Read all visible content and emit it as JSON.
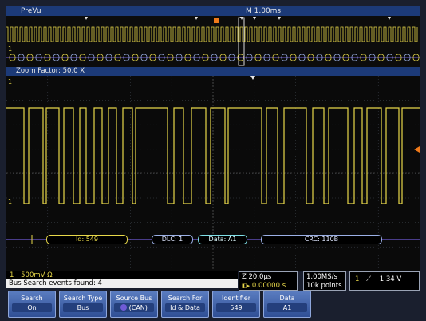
{
  "header": {
    "mode": "PreVu",
    "timebase": "M 1.00ms"
  },
  "zoom": {
    "label": "Zoom Factor: 50.0 X"
  },
  "bus": {
    "fields": [
      "Id: 549",
      "DLC: 1",
      "Data: A1",
      "CRC: 110B"
    ],
    "colors": {
      "id": "#e8d84a",
      "dlc": "#9bb0e6",
      "data": "#7fe0e8",
      "crc": "#9bb0e6",
      "line": "#6f5bd6"
    }
  },
  "channel": {
    "num": "1",
    "scale": "500mV Ω"
  },
  "status": {
    "search_result": "Bus Search events found: 4"
  },
  "readout": {
    "zoom_time": "Z 20.0μs",
    "position": "0.00000 s",
    "sample_rate": "1.00MS/s",
    "record": "10k points",
    "trig_level": "1.34 V"
  },
  "buttons": [
    {
      "title": "Search",
      "value": "On"
    },
    {
      "title": "Search Type",
      "value": "Bus"
    },
    {
      "title": "Source Bus",
      "value": "(CAN)"
    },
    {
      "title": "Search For",
      "value": "Id & Data"
    },
    {
      "title": "Identifier",
      "value": "549"
    },
    {
      "title": "Data",
      "value": "A1"
    }
  ],
  "colors": {
    "trace": "#e8d84a",
    "accent": "#1c3a78",
    "grid": "#444a55"
  }
}
